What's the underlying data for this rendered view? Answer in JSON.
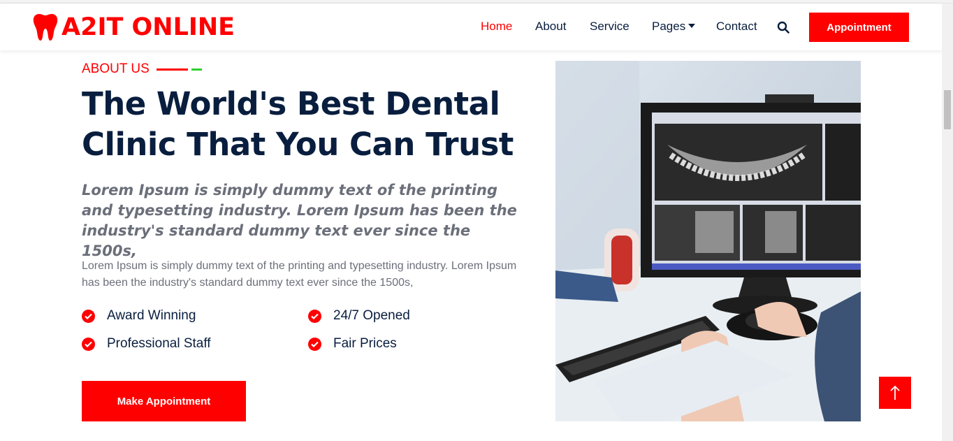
{
  "brand": {
    "name": "A2IT ONLINE",
    "logo_icon": "tooth-icon",
    "color": "#ff0000"
  },
  "nav": {
    "items": [
      {
        "label": "Home",
        "active": true
      },
      {
        "label": "About",
        "active": false
      },
      {
        "label": "Service",
        "active": false
      },
      {
        "label": "Pages",
        "active": false,
        "dropdown": true
      },
      {
        "label": "Contact",
        "active": false
      }
    ],
    "search_icon": "search-icon",
    "cta_label": "Appointment"
  },
  "about": {
    "section_label": "ABOUT US",
    "headline_line1": "The World's Best Dental",
    "headline_line2": "Clinic That You Can Trust",
    "lead": "Lorem Ipsum is simply dummy text of the printing and typesetting industry. Lorem Ipsum has been the industry's standard dummy text ever since the 1500s,",
    "body": "Lorem Ipsum is simply dummy text of the printing and typesetting industry. Lorem Ipsum has been the industry's standard dummy text ever since the 1500s,",
    "features": [
      "Award Winning",
      "24/7 Opened",
      "Professional Staff",
      "Fair Prices"
    ],
    "button_label": "Make Appointment"
  },
  "photo": {
    "subject": "dentist viewing dental x-ray on computer monitor"
  },
  "colors": {
    "accent": "#ff0000",
    "heading": "#091e3e",
    "muted": "#6b6f7a",
    "secondary_accent": "#2ed12e"
  },
  "scroll_top_icon": "arrow-up-icon"
}
